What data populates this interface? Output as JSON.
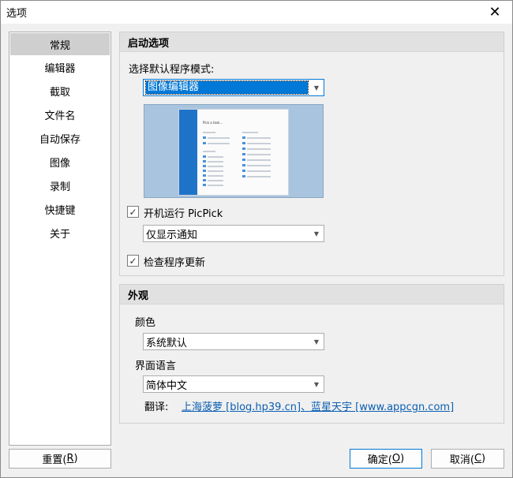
{
  "window": {
    "title": "选项"
  },
  "sidebar": {
    "items": [
      {
        "label": "常规",
        "active": true
      },
      {
        "label": "编辑器"
      },
      {
        "label": "截取"
      },
      {
        "label": "文件名"
      },
      {
        "label": "自动保存"
      },
      {
        "label": "图像"
      },
      {
        "label": "录制"
      },
      {
        "label": "快捷键"
      },
      {
        "label": "关于"
      }
    ]
  },
  "startup": {
    "header": "启动选项",
    "mode_label": "选择默认程序模式:",
    "mode_value": "图像编辑器",
    "preview": {
      "heading": "Pick a task..."
    },
    "run_on_startup": {
      "label": "开机运行 PicPick",
      "checked": true
    },
    "startup_mode_value": "仅显示通知",
    "check_updates": {
      "label": "检查程序更新",
      "checked": true
    }
  },
  "appearance": {
    "header": "外观",
    "color_label": "颜色",
    "color_value": "系统默认",
    "language_label": "界面语言",
    "language_value": "简体中文",
    "translation_label": "翻译:",
    "translation_link": "上海菠萝 [blog.hp39.cn]、蓝星天宇 [www.appcgn.com]"
  },
  "buttons": {
    "reset_text": "重置(",
    "reset_key": "R",
    "reset_close": ")",
    "ok_text": "确定(",
    "ok_key": "O",
    "ok_close": ")",
    "cancel_text": "取消(",
    "cancel_key": "C",
    "cancel_close": ")"
  }
}
